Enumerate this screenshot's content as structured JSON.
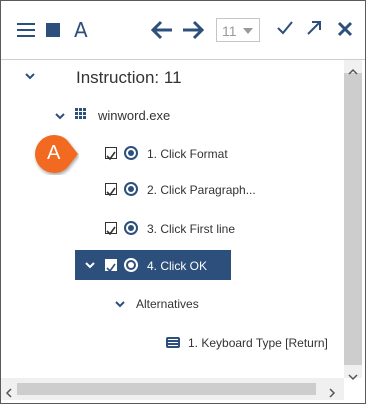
{
  "toolbar": {
    "icons": [
      "menu-icon",
      "stop-icon",
      "font-icon",
      "arrow-left-icon",
      "arrow-right-icon",
      "check-icon",
      "popout-icon",
      "close-icon"
    ],
    "font_glyph": "A",
    "step_select": {
      "value": "11",
      "placeholder": ""
    }
  },
  "tree": {
    "title": "Instruction: 11",
    "process": "winword.exe",
    "steps": [
      {
        "label": "1. Click Format",
        "checked": true,
        "selected": false
      },
      {
        "label": "2. Click Paragraph...",
        "checked": true,
        "selected": false
      },
      {
        "label": "3. Click First line",
        "checked": true,
        "selected": false
      },
      {
        "label": "4. Click OK",
        "checked": true,
        "selected": true
      }
    ],
    "alternatives_label": "Alternatives",
    "alternatives": [
      {
        "label": "1. Keyboard Type [Return]",
        "icon": "keyboard-icon"
      }
    ]
  },
  "badge": {
    "letter": "A",
    "color": "#f26a21"
  },
  "colors": {
    "accent": "#2d4f7c",
    "selected_row": "#2d4f7c"
  }
}
